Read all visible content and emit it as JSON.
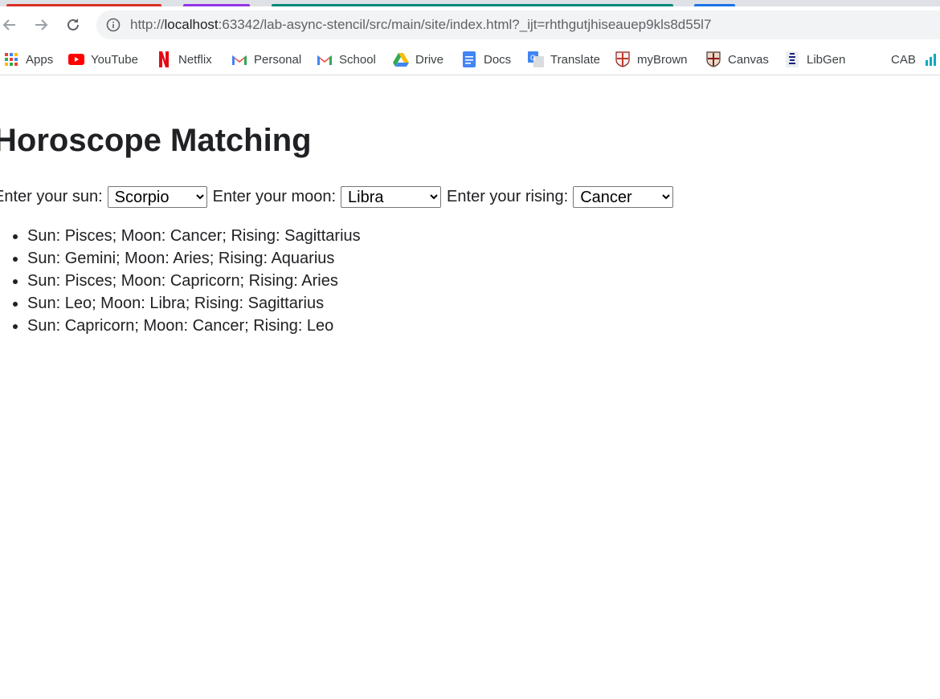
{
  "browser": {
    "url_prefix": "http://",
    "url_host": "localhost",
    "url_rest": ":63342/lab-async-stencil/src/main/site/index.html?_ijt=rhthgutjhiseauep9kls8d55l7",
    "tab_colors": [
      "#d93025",
      "#9334e6",
      "#00897b",
      "#1a73e8"
    ]
  },
  "bookmarks": [
    {
      "label": "Apps",
      "icon": "apps-grid-icon"
    },
    {
      "label": "YouTube",
      "icon": "youtube-icon"
    },
    {
      "label": "Netflix",
      "icon": "netflix-icon"
    },
    {
      "label": "Personal",
      "icon": "gmail-icon"
    },
    {
      "label": "School",
      "icon": "gmail-icon"
    },
    {
      "label": "Drive",
      "icon": "drive-icon"
    },
    {
      "label": "Docs",
      "icon": "docs-icon"
    },
    {
      "label": "Translate",
      "icon": "translate-icon"
    },
    {
      "label": "myBrown",
      "icon": "brown-shield-icon"
    },
    {
      "label": "Canvas",
      "icon": "brown-crest-icon"
    },
    {
      "label": "LibGen",
      "icon": "libgen-icon"
    },
    {
      "label": "CAB",
      "icon": ""
    },
    {
      "label": "",
      "icon": "bar-chart-icon"
    }
  ],
  "page": {
    "title": "Horoscope Matching",
    "form": {
      "sun_label": "Enter your sun:",
      "sun_value": "Scorpio",
      "moon_label": "Enter your moon:",
      "moon_value": "Libra",
      "rising_label": "Enter your rising:",
      "rising_value": "Cancer"
    },
    "matches": [
      "Sun: Pisces; Moon: Cancer; Rising: Sagittarius",
      "Sun: Gemini; Moon: Aries; Rising: Aquarius",
      "Sun: Pisces; Moon: Capricorn; Rising: Aries",
      "Sun: Leo; Moon: Libra; Rising: Sagittarius",
      "Sun: Capricorn; Moon: Cancer; Rising: Leo"
    ]
  }
}
